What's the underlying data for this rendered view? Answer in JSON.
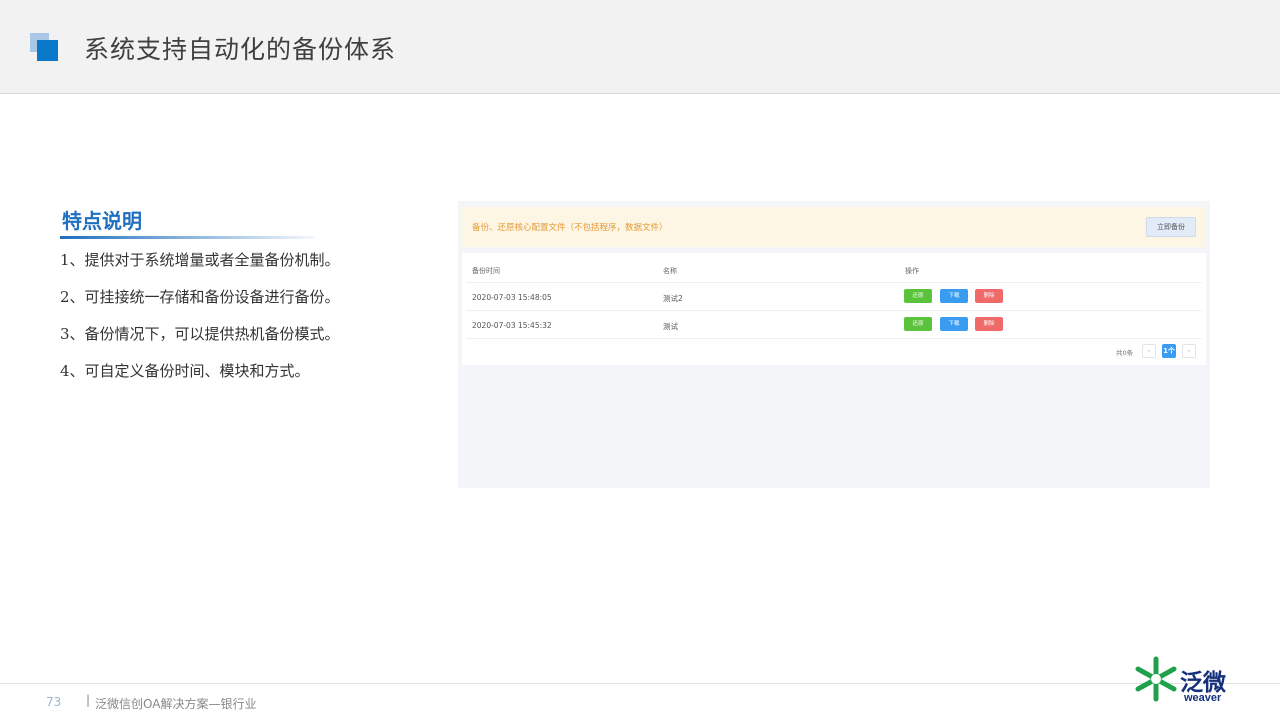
{
  "header": {
    "title": "系统支持自动化的备份体系"
  },
  "features": {
    "title": "特点说明",
    "items": [
      "1、提供对于系统增量或者全量备份机制。",
      "2、可挂接统一存储和备份设备进行备份。",
      "3、备份情况下，可以提供热机备份模式。",
      "4、可自定义备份时间、模块和方式。"
    ]
  },
  "screenshot": {
    "notice": "备份、还原核心配置文件（不包括程序，数据文件）",
    "backup_now_label": "立即备份",
    "columns": [
      "备份时间",
      "名称",
      "操作"
    ],
    "rows": [
      {
        "time": "2020-07-03 15:48:05",
        "name": "测试2"
      },
      {
        "time": "2020-07-03 15:45:32",
        "name": "测试"
      }
    ],
    "actions": {
      "restore": "还原",
      "download": "下载",
      "delete": "删除"
    },
    "pager": {
      "total": "共0条",
      "prev": "‹",
      "current": "1个",
      "next": "›"
    },
    "colors": {
      "restore": "#5bc23b",
      "download": "#3a9cf0",
      "delete": "#f06a6a",
      "notice_text": "#e39b36"
    }
  },
  "footer": {
    "page_number": "73",
    "separator": "|",
    "text": "泛微信创OA解决方案—银行业"
  },
  "logo": {
    "cn": "泛微",
    "en": "weaver",
    "icon": "weaver-logo-icon"
  },
  "theme": {
    "accent": "#0a78c9",
    "title_blue": "#1f6fbf"
  }
}
